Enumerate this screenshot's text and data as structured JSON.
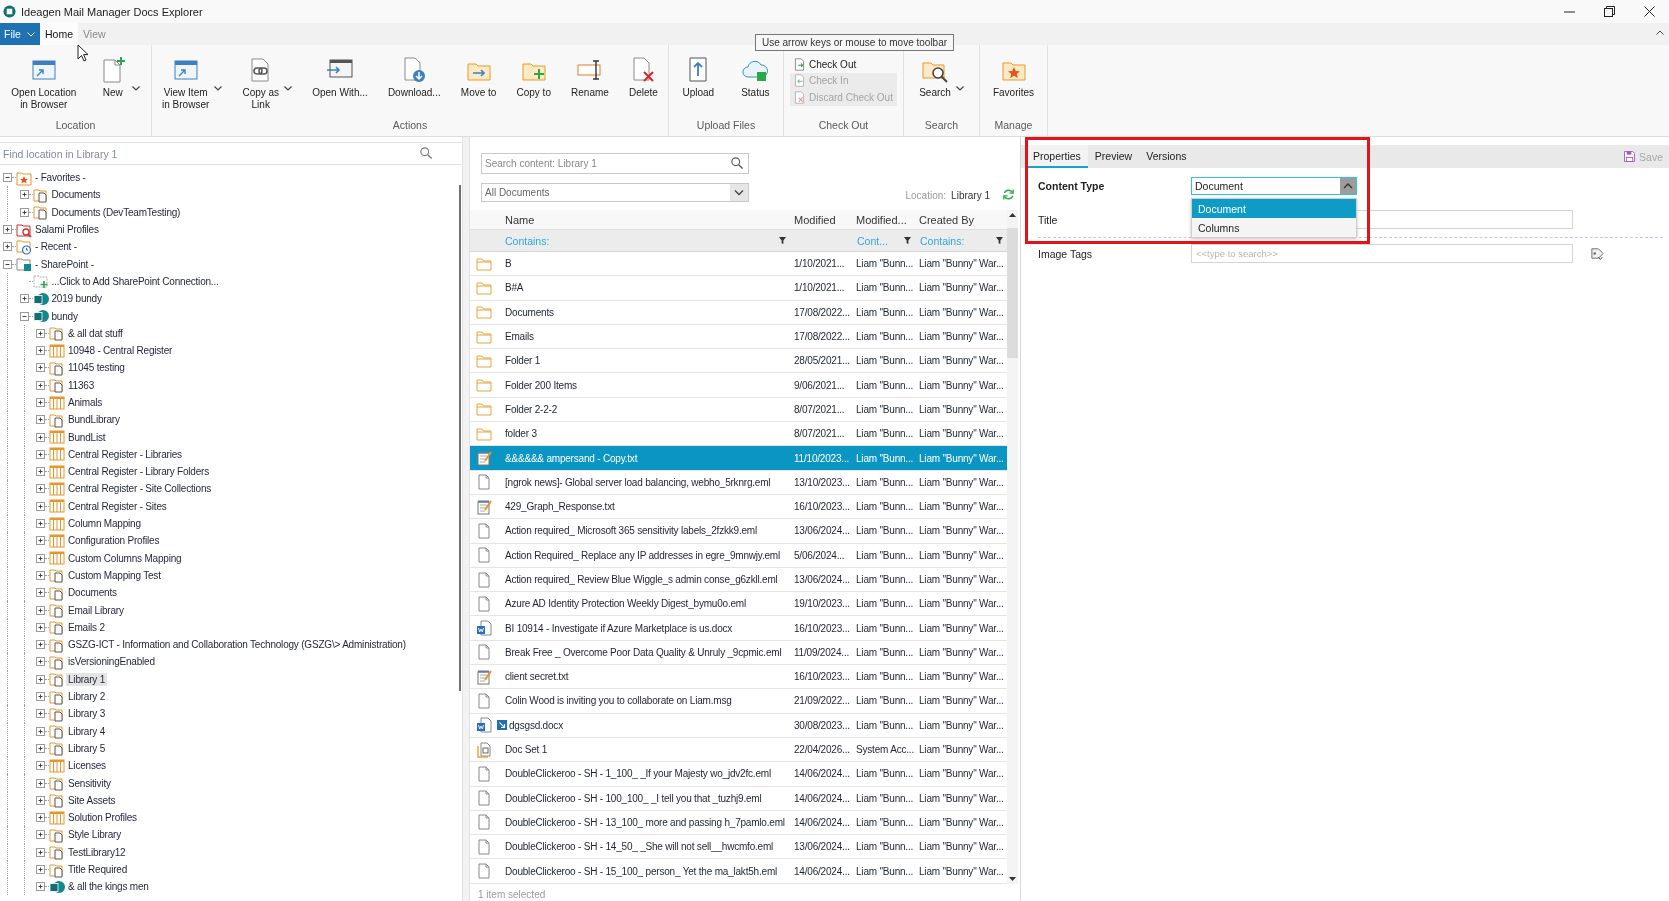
{
  "window": {
    "title": "Ideagen Mail Manager Docs Explorer"
  },
  "menu": {
    "file": "File",
    "tabs": [
      {
        "label": "Home",
        "selected": true
      },
      {
        "label": "View",
        "selected": false
      }
    ]
  },
  "tooltip": {
    "text": "Use arrow keys or mouse to move toolbar"
  },
  "ribbon": {
    "groups": [
      {
        "label": "Location",
        "kind": "large",
        "buttons": [
          {
            "label": "Open Location\nin Browser",
            "menu": false
          },
          {
            "label": "New",
            "menu": true
          }
        ]
      },
      {
        "label": "Actions",
        "kind": "large",
        "buttons": [
          {
            "label": "View Item\nin Browser",
            "menu": true
          },
          {
            "label": "Copy as\nLink",
            "menu": true
          },
          {
            "label": "Open With...",
            "menu": false
          },
          {
            "label": "Download...",
            "menu": false
          },
          {
            "label": "Move to",
            "menu": false
          },
          {
            "label": "Copy to",
            "menu": false
          },
          {
            "label": "Rename",
            "menu": false
          },
          {
            "label": "Delete",
            "menu": false
          }
        ]
      },
      {
        "label": "Upload Files",
        "kind": "large",
        "buttons": [
          {
            "label": "Upload",
            "menu": false
          },
          {
            "label": "Status",
            "menu": false
          }
        ]
      },
      {
        "label": "Check Out",
        "kind": "small",
        "buttons": [
          {
            "label": "Check Out",
            "disabled": false
          },
          {
            "label": "Check In",
            "disabled": true
          },
          {
            "label": "Discard Check Out",
            "disabled": true
          }
        ]
      },
      {
        "label": "Search",
        "kind": "large",
        "buttons": [
          {
            "label": "Search",
            "menu": true
          }
        ]
      },
      {
        "label": "Manage",
        "kind": "large",
        "buttons": [
          {
            "label": "Favorites",
            "menu": false
          }
        ]
      }
    ]
  },
  "tree": {
    "search": {
      "placeholder": "Find location in Library 1"
    },
    "nodes": [
      {
        "label": "- Favorites -",
        "kind": "favorites",
        "expanded": true,
        "selected": false,
        "children": [
          {
            "label": "Documents",
            "kind": "library",
            "expanded": false,
            "selected": false
          },
          {
            "label": "Documents (DevTeamTesting)",
            "kind": "library",
            "expanded": false,
            "selected": false
          }
        ]
      },
      {
        "label": "Salami Profiles",
        "kind": "profiles",
        "expanded": false,
        "selected": false
      },
      {
        "label": "- Recent -",
        "kind": "recent",
        "expanded": false,
        "selected": false
      },
      {
        "label": "- SharePoint -",
        "kind": "sharepoint",
        "expanded": true,
        "selected": false,
        "children": [
          {
            "label": "...Click to Add SharePoint Connection...",
            "kind": "connect",
            "selected": false
          },
          {
            "label": "2019 bundy",
            "kind": "site",
            "expanded": false,
            "selected": false
          },
          {
            "label": "bundy",
            "kind": "site",
            "expanded": true,
            "selected": false,
            "children": [
              {
                "label": "& all dat stuff",
                "kind": "library",
                "expanded": false,
                "selected": false
              },
              {
                "label": "10948 - Central Register",
                "kind": "list",
                "expanded": false,
                "selected": false
              },
              {
                "label": "11045 testing",
                "kind": "library",
                "expanded": false,
                "selected": false
              },
              {
                "label": "11363",
                "kind": "library",
                "expanded": false,
                "selected": false
              },
              {
                "label": "Animals",
                "kind": "list",
                "expanded": false,
                "selected": false
              },
              {
                "label": "BundLibrary",
                "kind": "library",
                "expanded": false,
                "selected": false
              },
              {
                "label": "BundList",
                "kind": "list",
                "expanded": false,
                "selected": false
              },
              {
                "label": "Central Register - Libraries",
                "kind": "list",
                "expanded": false,
                "selected": false
              },
              {
                "label": "Central Register - Library Folders",
                "kind": "list",
                "expanded": false,
                "selected": false
              },
              {
                "label": "Central Register - Site Collections",
                "kind": "list",
                "expanded": false,
                "selected": false
              },
              {
                "label": "Central Register - Sites",
                "kind": "list",
                "expanded": false,
                "selected": false
              },
              {
                "label": "Column Mapping",
                "kind": "list",
                "expanded": false,
                "selected": false
              },
              {
                "label": "Configuration Profiles",
                "kind": "list",
                "expanded": false,
                "selected": false
              },
              {
                "label": "Custom Columns Mapping",
                "kind": "list",
                "expanded": false,
                "selected": false
              },
              {
                "label": "Custom Mapping Test",
                "kind": "library",
                "expanded": false,
                "selected": false
              },
              {
                "label": "Documents",
                "kind": "library",
                "expanded": false,
                "selected": false
              },
              {
                "label": "Email Library",
                "kind": "library",
                "expanded": false,
                "selected": false
              },
              {
                "label": "Emails 2",
                "kind": "library",
                "expanded": false,
                "selected": false
              },
              {
                "label": "GSZG-ICT - Information and Collaboration Technology (GSZG\\> Administration)",
                "kind": "library",
                "expanded": false,
                "selected": false
              },
              {
                "label": "isVersioningEnabled",
                "kind": "library",
                "expanded": false,
                "selected": false
              },
              {
                "label": "Library 1",
                "kind": "library",
                "expanded": false,
                "selected": true
              },
              {
                "label": "Library 2",
                "kind": "library",
                "expanded": false,
                "selected": false
              },
              {
                "label": "Library 3",
                "kind": "library",
                "expanded": false,
                "selected": false
              },
              {
                "label": "Library 4",
                "kind": "library",
                "expanded": false,
                "selected": false
              },
              {
                "label": "Library 5",
                "kind": "library",
                "expanded": false,
                "selected": false
              },
              {
                "label": "Licenses",
                "kind": "list",
                "expanded": false,
                "selected": false
              },
              {
                "label": "Sensitivity",
                "kind": "library",
                "expanded": false,
                "selected": false
              },
              {
                "label": "Site Assets",
                "kind": "library",
                "expanded": false,
                "selected": false
              },
              {
                "label": "Solution Profiles",
                "kind": "list",
                "expanded": false,
                "selected": false
              },
              {
                "label": "Style Library",
                "kind": "library",
                "expanded": false,
                "selected": false
              },
              {
                "label": "TestLibrary12",
                "kind": "library",
                "expanded": false,
                "selected": false
              },
              {
                "label": "Title Required",
                "kind": "library",
                "expanded": false,
                "selected": false
              },
              {
                "label": "& all the kings men",
                "kind": "site",
                "expanded": false,
                "selected": false
              }
            ]
          }
        ]
      }
    ]
  },
  "content": {
    "search": {
      "placeholder": "Search content: Library 1"
    },
    "view": {
      "value": "All Documents"
    },
    "location": {
      "label": "Location:",
      "value": "Library 1"
    }
  },
  "table": {
    "columns": [
      {
        "label": "Name",
        "filter": "Contains:"
      },
      {
        "label": "Modified"
      },
      {
        "label": "Modified...",
        "filter": "Cont..."
      },
      {
        "label": "Created By",
        "filter": "Contains:"
      }
    ],
    "rows": [
      {
        "kind": "folder",
        "name": "B",
        "modified": "1/10/2021...",
        "modified_by": "Liam \"Bunn...",
        "created_by": "Liam \"Bunny\" War...",
        "selected": false,
        "marked": false
      },
      {
        "kind": "folder",
        "name": "B#A",
        "modified": "1/10/2021...",
        "modified_by": "Liam \"Bunn...",
        "created_by": "Liam \"Bunny\" War...",
        "selected": false,
        "marked": false
      },
      {
        "kind": "folder",
        "name": "Documents",
        "modified": "17/08/2022...",
        "modified_by": "Liam \"Bunn...",
        "created_by": "Liam \"Bunny\" War...",
        "selected": false,
        "marked": false
      },
      {
        "kind": "folder",
        "name": "Emails",
        "modified": "17/08/2022...",
        "modified_by": "Liam \"Bunn...",
        "created_by": "Liam \"Bunny\" War...",
        "selected": false,
        "marked": false
      },
      {
        "kind": "folder",
        "name": "Folder 1",
        "modified": "28/05/2021...",
        "modified_by": "Liam \"Bunn...",
        "created_by": "Liam \"Bunny\" War...",
        "selected": false,
        "marked": false
      },
      {
        "kind": "folder",
        "name": "Folder 200 Items",
        "modified": "9/06/2021...",
        "modified_by": "Liam \"Bunn...",
        "created_by": "Liam \"Bunny\" War...",
        "selected": false,
        "marked": false
      },
      {
        "kind": "folder",
        "name": "Folder 2-2-2",
        "modified": "8/07/2021...",
        "modified_by": "Liam \"Bunn...",
        "created_by": "Liam \"Bunny\" War...",
        "selected": false,
        "marked": false
      },
      {
        "kind": "folder",
        "name": "folder 3",
        "modified": "8/07/2021...",
        "modified_by": "Liam \"Bunn...",
        "created_by": "Liam \"Bunny\" War...",
        "selected": false,
        "marked": false
      },
      {
        "kind": "text",
        "name": "&&&&&& ampersand - Copy.txt",
        "modified": "11/10/2023...",
        "modified_by": "Liam \"Bunn...",
        "created_by": "Liam \"Bunny\" War...",
        "selected": true,
        "marked": false
      },
      {
        "kind": "blank",
        "name": "[ngrok news]- Global server load balancing, webho_5rknrg.eml",
        "modified": "13/10/2023...",
        "modified_by": "Liam \"Bunn...",
        "created_by": "Liam \"Bunny\" War...",
        "selected": false,
        "marked": false
      },
      {
        "kind": "text",
        "name": "429_Graph_Response.txt",
        "modified": "16/10/2023...",
        "modified_by": "Liam \"Bunn...",
        "created_by": "Liam \"Bunny\" War...",
        "selected": false,
        "marked": false
      },
      {
        "kind": "blank",
        "name": "Action required_ Microsoft 365 sensitivity labels_2fzkk9.eml",
        "modified": "13/06/2024...",
        "modified_by": "Liam \"Bunn...",
        "created_by": "Liam \"Bunny\" War...",
        "selected": false,
        "marked": false
      },
      {
        "kind": "blank",
        "name": "Action Required_ Replace any IP addresses in egre_9mnwjy.eml",
        "modified": "5/06/2024...",
        "modified_by": "Liam \"Bunn...",
        "created_by": "Liam \"Bunny\" War...",
        "selected": false,
        "marked": false
      },
      {
        "kind": "blank",
        "name": "Action required_ Review Blue Wiggle_s admin conse_g6zkll.eml",
        "modified": "13/06/2024...",
        "modified_by": "Liam \"Bunn...",
        "created_by": "Liam \"Bunny\" War...",
        "selected": false,
        "marked": false
      },
      {
        "kind": "blank",
        "name": "Azure AD Identity Protection Weekly Digest_bymu0o.eml",
        "modified": "19/10/2023...",
        "modified_by": "Liam \"Bunn...",
        "created_by": "Liam \"Bunny\" War...",
        "selected": false,
        "marked": false
      },
      {
        "kind": "word",
        "name": "BI 10914 - Investigate if Azure Marketplace is us.docx",
        "modified": "16/10/2023...",
        "modified_by": "Liam \"Bunn...",
        "created_by": "Liam \"Bunny\" War...",
        "selected": false,
        "marked": false
      },
      {
        "kind": "blank",
        "name": "Break Free _ Overcome Poor Data Quality & Unruly _9cpmic.eml",
        "modified": "11/09/2024...",
        "modified_by": "Liam \"Bunn...",
        "created_by": "Liam \"Bunny\" War...",
        "selected": false,
        "marked": false
      },
      {
        "kind": "text",
        "name": "client secret.txt",
        "modified": "16/10/2023...",
        "modified_by": "Liam \"Bunn...",
        "created_by": "Liam \"Bunny\" War...",
        "selected": false,
        "marked": false
      },
      {
        "kind": "blank",
        "name": "Colin Wood is inviting you to collaborate on Liam.msg",
        "modified": "21/09/2022...",
        "modified_by": "Liam \"Bunn...",
        "created_by": "Liam \"Bunny\" War...",
        "selected": false,
        "marked": false
      },
      {
        "kind": "word",
        "name": "dgsgsd.docx",
        "modified": "30/08/2023...",
        "modified_by": "Liam \"Bunn...",
        "created_by": "Liam \"Bunny\" War...",
        "selected": false,
        "marked": true
      },
      {
        "kind": "docset",
        "name": "Doc Set 1",
        "modified": "22/04/2026...",
        "modified_by": "System Acc...",
        "created_by": "Liam \"Bunny\" War...",
        "selected": false,
        "marked": false
      },
      {
        "kind": "blank",
        "name": "DoubleClickeroo - SH - 1_100_ _If your Majesty wo_jdv2fc.eml",
        "modified": "14/06/2024...",
        "modified_by": "Liam \"Bunn...",
        "created_by": "Liam \"Bunny\" War...",
        "selected": false,
        "marked": false
      },
      {
        "kind": "blank",
        "name": "DoubleClickeroo - SH - 100_100_ _I tell you that _tuzhj9.eml",
        "modified": "14/06/2024...",
        "modified_by": "Liam \"Bunn...",
        "created_by": "Liam \"Bunny\" War...",
        "selected": false,
        "marked": false
      },
      {
        "kind": "blank",
        "name": "DoubleClickeroo - SH - 13_100_ more and passing h_7pamlo.eml",
        "modified": "14/06/2024...",
        "modified_by": "Liam \"Bunn...",
        "created_by": "Liam \"Bunny\" War...",
        "selected": false,
        "marked": false
      },
      {
        "kind": "blank",
        "name": "DoubleClickeroo - SH - 14_50_ _She will not sell__hwcmfo.eml",
        "modified": "13/06/2024...",
        "modified_by": "Liam \"Bunn...",
        "created_by": "Liam \"Bunny\" War...",
        "selected": false,
        "marked": false
      },
      {
        "kind": "blank",
        "name": "DoubleClickeroo - SH - 15_100_ person_ Yet the ma_lakt5h.eml",
        "modified": "14/06/2024...",
        "modified_by": "Liam \"Bunn...",
        "created_by": "Liam \"Bunny\" War...",
        "selected": false,
        "marked": false
      }
    ]
  },
  "status_bar": {
    "text": "1 item selected"
  },
  "details": {
    "tabs": [
      {
        "label": "Properties",
        "selected": true
      },
      {
        "label": "Preview",
        "selected": false
      },
      {
        "label": "Versions",
        "selected": false
      }
    ],
    "save": {
      "label": "Save",
      "disabled": true
    },
    "fields": [
      {
        "label": "Content Type",
        "kind": "dropdown",
        "required": true,
        "value": "Document",
        "expanded": true,
        "options": [
          {
            "label": "Document",
            "selected": true
          },
          {
            "label": "Columns",
            "selected": false
          }
        ]
      },
      {
        "label": "Title",
        "kind": "text",
        "required": false
      },
      {
        "label": "Image Tags",
        "kind": "tags",
        "required": false,
        "placeholder": "<<type to search>>"
      }
    ]
  }
}
